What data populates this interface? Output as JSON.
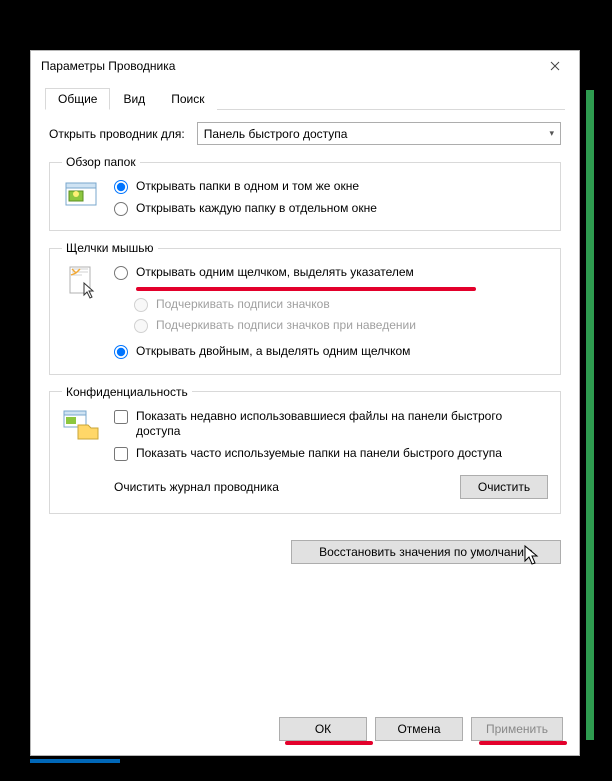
{
  "title": "Параметры Проводника",
  "tabs": {
    "general": "Общие",
    "view": "Вид",
    "search": "Поиск"
  },
  "open_for_label": "Открыть проводник для:",
  "open_for_value": "Панель быстрого доступа",
  "browse": {
    "legend": "Обзор папок",
    "same_window": "Открывать папки в одном и том же окне",
    "new_window": "Открывать каждую папку в отдельном окне"
  },
  "click": {
    "legend": "Щелчки мышью",
    "single": "Открывать одним щелчком, выделять указателем",
    "underline_always": "Подчеркивать подписи значков",
    "underline_hover": "Подчеркивать подписи значков при наведении",
    "double": "Открывать двойным, а выделять одним щелчком"
  },
  "privacy": {
    "legend": "Конфиденциальность",
    "recent_files": "Показать недавно использовавшиеся файлы на панели быстрого доступа",
    "frequent_folders": "Показать часто используемые папки на панели быстрого доступа",
    "clear_label": "Очистить журнал проводника",
    "clear_btn": "Очистить"
  },
  "restore_defaults": "Восстановить значения по умолчанию",
  "buttons": {
    "ok": "ОК",
    "cancel": "Отмена",
    "apply": "Применить"
  }
}
